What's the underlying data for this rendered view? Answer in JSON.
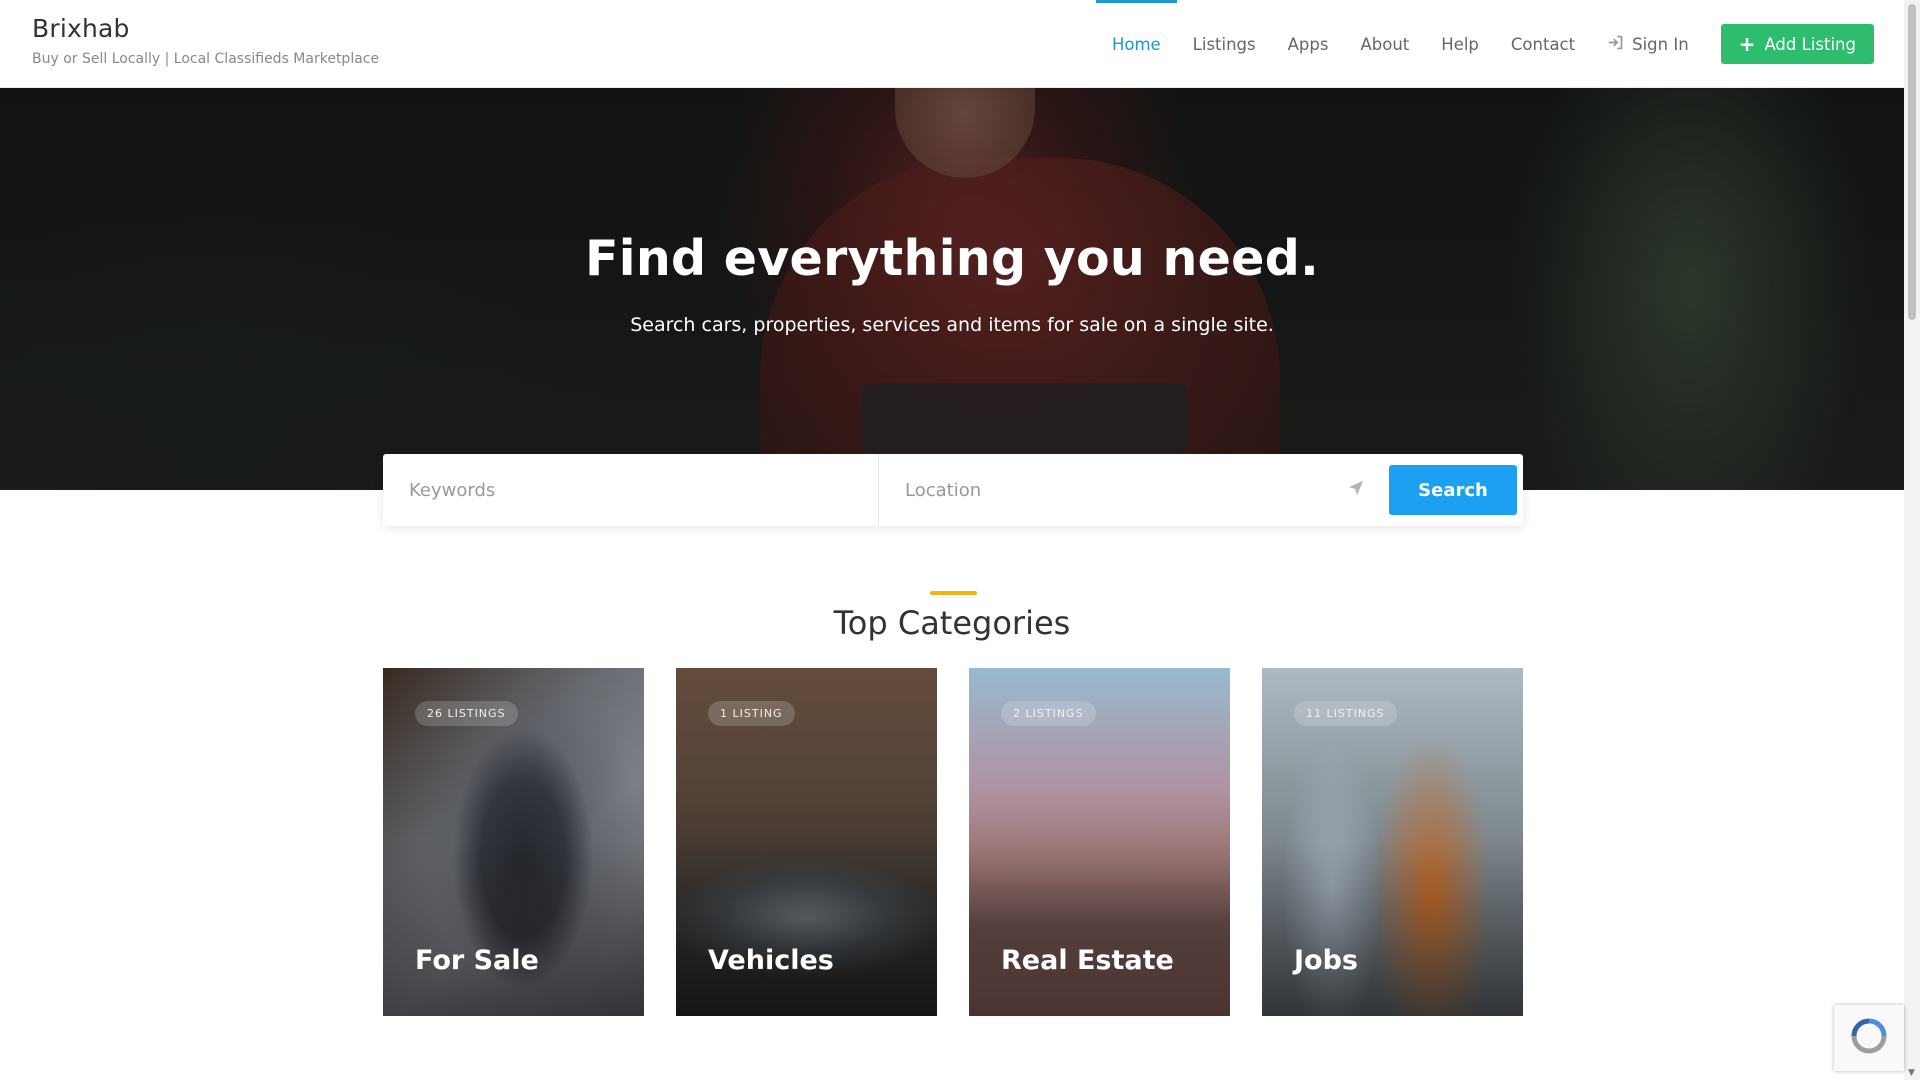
{
  "brand": {
    "name": "Brixhab",
    "tagline": "Buy or Sell Locally | Local Classifieds Marketplace"
  },
  "nav": {
    "items": [
      {
        "label": "Home",
        "active": true
      },
      {
        "label": "Listings"
      },
      {
        "label": "Apps"
      },
      {
        "label": "About"
      },
      {
        "label": "Help"
      },
      {
        "label": "Contact"
      }
    ],
    "sign_in": "Sign In",
    "add_listing": "Add Listing"
  },
  "hero": {
    "title": "Find everything you need.",
    "subtitle": "Search cars, properties, services and items for sale on a single site."
  },
  "search": {
    "keywords_placeholder": "Keywords",
    "location_placeholder": "Location",
    "button": "Search"
  },
  "categories": {
    "title": "Top Categories",
    "items": [
      {
        "name": "For Sale",
        "count": "26 LISTINGS"
      },
      {
        "name": "Vehicles",
        "count": "1 LISTING"
      },
      {
        "name": "Real Estate",
        "count": "2 LISTINGS"
      },
      {
        "name": "Jobs",
        "count": "11 LISTINGS"
      }
    ]
  },
  "colors": {
    "accent": "#2196d6",
    "add_button": "#2ebd6e",
    "search_button": "#1ea0f2",
    "section_bar": "#f5b412"
  },
  "icons": {
    "sign_in": "sign-in-icon",
    "location": "location-arrow-icon",
    "add": "plus-icon",
    "recaptcha": "recaptcha-icon"
  }
}
